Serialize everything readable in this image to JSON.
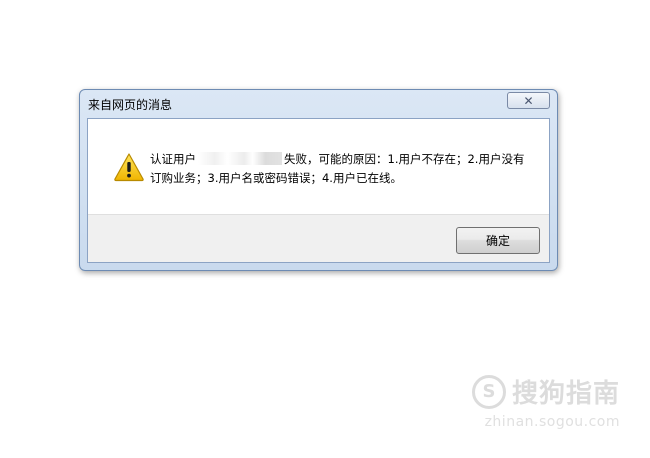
{
  "dialog": {
    "title": "来自网页的消息",
    "close_symbol": "✕",
    "icon": "warning-icon",
    "message_part1": "认证用户",
    "message_part2": "失败，可能的原因：1.用户不存在；2.用户没有订购业务；3.用户名或密码错误；4.用户已在线。",
    "ok_label": "确定"
  },
  "watermark": {
    "logo_letter": "S",
    "brand": "搜狗指南",
    "url": "zhinan.sogou.com"
  },
  "colors": {
    "title_gradient_top": "#dbe7f5",
    "title_gradient_bottom": "#c9daee",
    "warning_yellow": "#f5c400",
    "button_face": "#ebebeb"
  }
}
